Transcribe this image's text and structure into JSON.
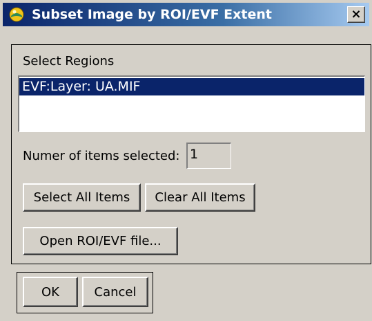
{
  "window": {
    "title": "Subset Image by ROI/EVF Extent",
    "icon": "idl-globe-icon",
    "close_label": "×"
  },
  "regions": {
    "label": "Select Regions",
    "items": [
      "EVF:Layer: UA.MIF"
    ],
    "selected_index": 0
  },
  "count": {
    "label": "Numer of items selected:",
    "value": "1"
  },
  "buttons": {
    "select_all": "Select All Items",
    "clear_all": "Clear All Items",
    "open_file": "Open ROI/EVF file...",
    "ok": "OK",
    "cancel": "Cancel"
  },
  "colors": {
    "title_bar_start": "#0a246a",
    "selection": "#0a246a",
    "face": "#d4d0c8"
  }
}
